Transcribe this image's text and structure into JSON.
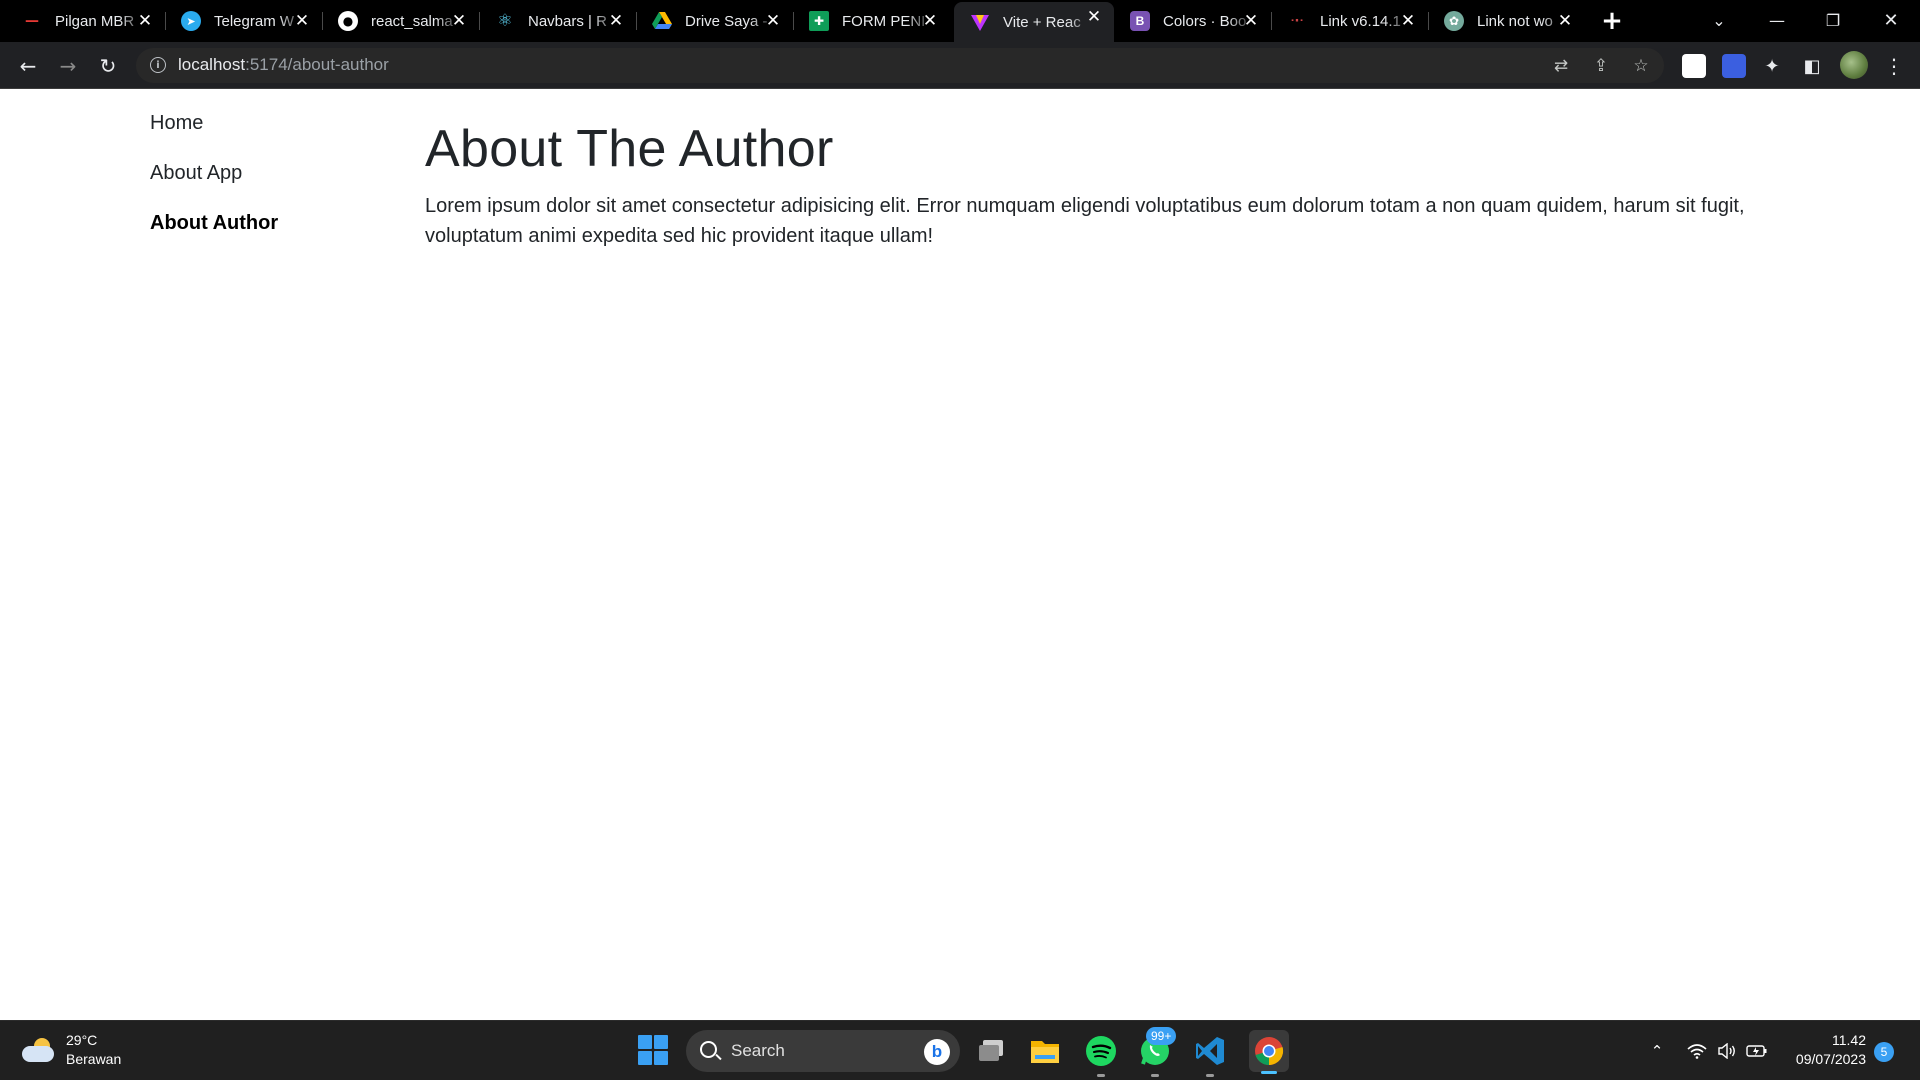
{
  "browser": {
    "tabs": [
      {
        "title": "Pilgan MBR",
        "favicon": "dash-icon",
        "color": "#2b6cb0"
      },
      {
        "title": "Telegram W",
        "favicon": "telegram-icon",
        "color": "#2aabee"
      },
      {
        "title": "react_salma",
        "favicon": "github-icon",
        "color": "#ffffff"
      },
      {
        "title": "Navbars | R",
        "favicon": "react-bootstrap-icon",
        "color": "#61dafb"
      },
      {
        "title": "Drive Saya -",
        "favicon": "google-drive-icon",
        "color": "#1fa463"
      },
      {
        "title": "FORM PENI",
        "favicon": "google-sheets-icon",
        "color": "#0f9d58"
      },
      {
        "title": "Vite + Reac",
        "favicon": "vite-icon",
        "color": "#bd34fe",
        "active": true
      },
      {
        "title": "Colors · Boo",
        "favicon": "bootstrap-icon",
        "color": "#7952b3"
      },
      {
        "title": "Link v6.14.1",
        "favicon": "react-router-icon",
        "color": "#ca4245"
      },
      {
        "title": "Link not wo",
        "favicon": "chatgpt-icon",
        "color": "#74aa9c"
      }
    ],
    "address": {
      "host": "localhost",
      "path": ":5174/about-author"
    }
  },
  "nav": {
    "home": "Home",
    "about_app": "About App",
    "about_author": "About Author"
  },
  "content": {
    "title": "About The Author",
    "body": "Lorem ipsum dolor sit amet consectetur adipisicing elit. Error numquam eligendi voluptatibus eum dolorum totam a non quam quidem, harum sit fugit, voluptatum animi expedita sed hic provident itaque ullam!"
  },
  "taskbar": {
    "weather_temp": "29°C",
    "weather_desc": "Berawan",
    "search_placeholder": "Search",
    "whatsapp_badge": "99+",
    "time": "11.42",
    "date": "09/07/2023",
    "notifications": "5"
  }
}
